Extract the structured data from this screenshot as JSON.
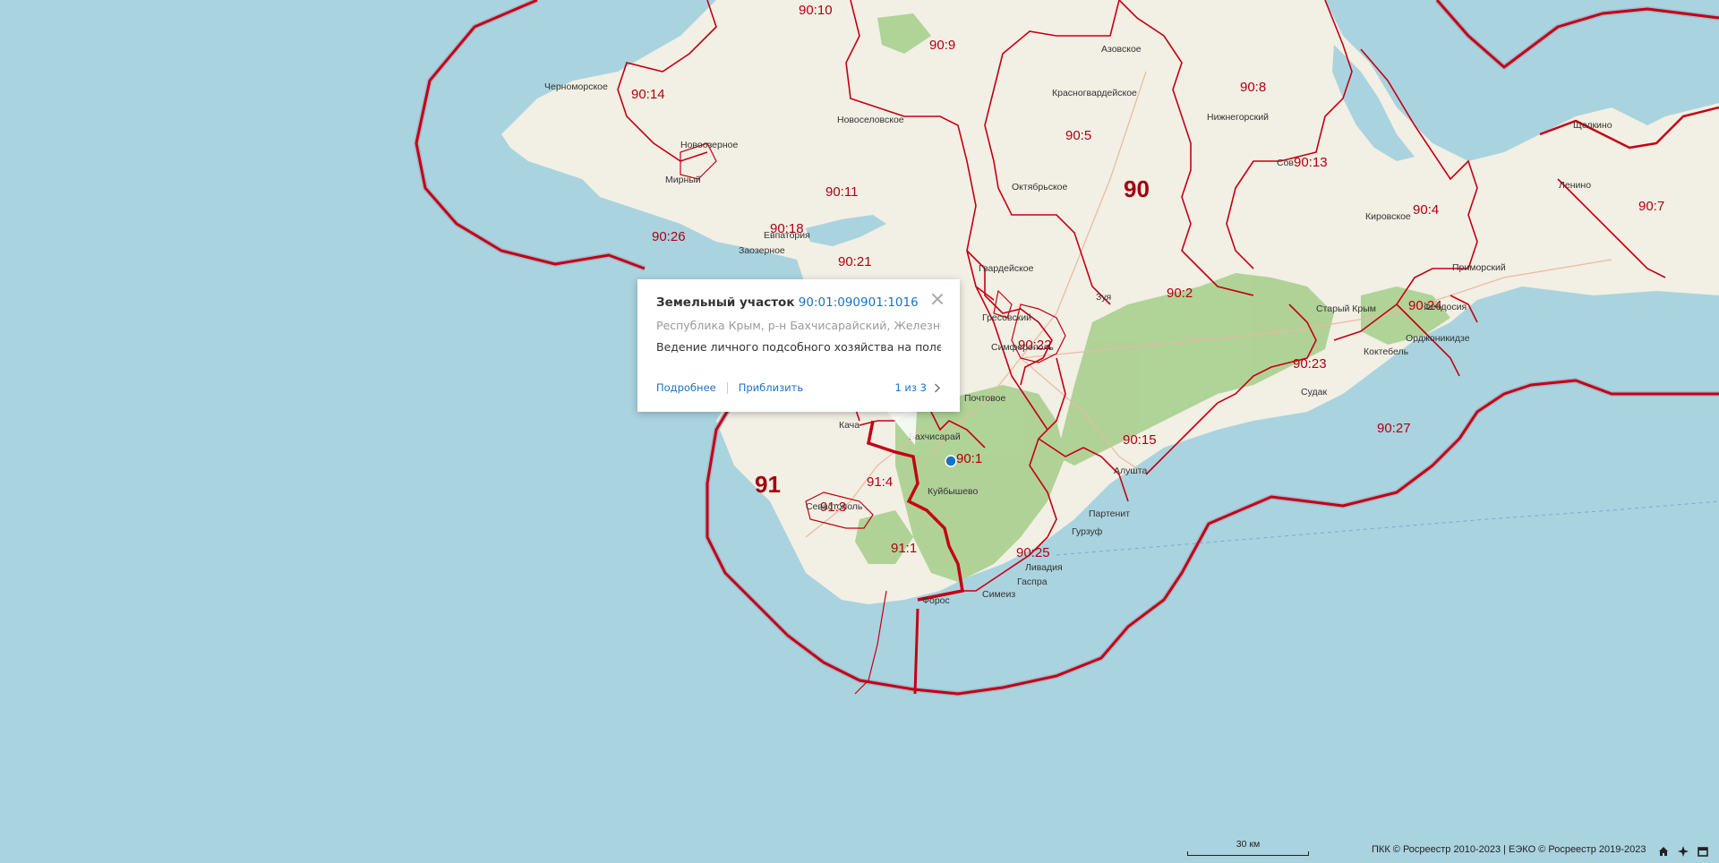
{
  "map": {
    "zones_big": [
      {
        "id": "zone-90",
        "label": "90"
      },
      {
        "id": "zone-91",
        "label": "91"
      }
    ],
    "zones": [
      "90:10",
      "90:9",
      "90:8",
      "90:14",
      "90:5",
      "90:13",
      "90:11",
      "90:4",
      "90:7",
      "90:18",
      "90:26",
      "90:21",
      "90:2",
      "90:24",
      "90:22",
      "90:23",
      "90:1",
      "91:4",
      "90:15",
      "90:27",
      "91:3",
      "91:1",
      "90:25"
    ],
    "towns": [
      "Азовское",
      "Черноморское",
      "Красногвардейское",
      "Нижнегорский",
      "Новоселовское",
      "Щелкино",
      "Новоозерное",
      "Мирный",
      "Октябрьское",
      "Сов",
      "Ленино",
      "Кировское",
      "Евпатория",
      "Заозерное",
      "Приморский",
      "Гвардейское",
      "Зуя",
      "Старый Крым",
      "Гресовский",
      "Симферополь",
      "Почтовое",
      "Кача",
      "Бахчисарай",
      "Алушта",
      "Куйбышево",
      "Судак",
      "Партенит",
      "Гурзуф",
      "Ливадия",
      "Гаспра",
      "Симеиз",
      "Севастополь",
      "Орджоникидзе",
      "Феодосия",
      "Коктебель",
      "Форос"
    ]
  },
  "popup": {
    "title_prefix": "Земельный участок",
    "cadastral_number": "90:01:090901:1016",
    "address": "Республика Крым, р-н Бахчисарайский, Железнодо...",
    "description": "Ведение личного подсобного хозяйства на полевых...",
    "details_label": "Подробнее",
    "zoom_label": "Приблизить",
    "pager": "1 из 3"
  },
  "footer": {
    "scale_label": "30 км",
    "copyright": "ПКК © Росреестр 2010-2023 | ЕЭКО © Росреестр 2019-2023"
  },
  "colors": {
    "sea": "#a9d3df",
    "land": "#f2efe4",
    "forest": "#a9cf8f",
    "boundary": "#c40012",
    "accent": "#1a72c4"
  }
}
